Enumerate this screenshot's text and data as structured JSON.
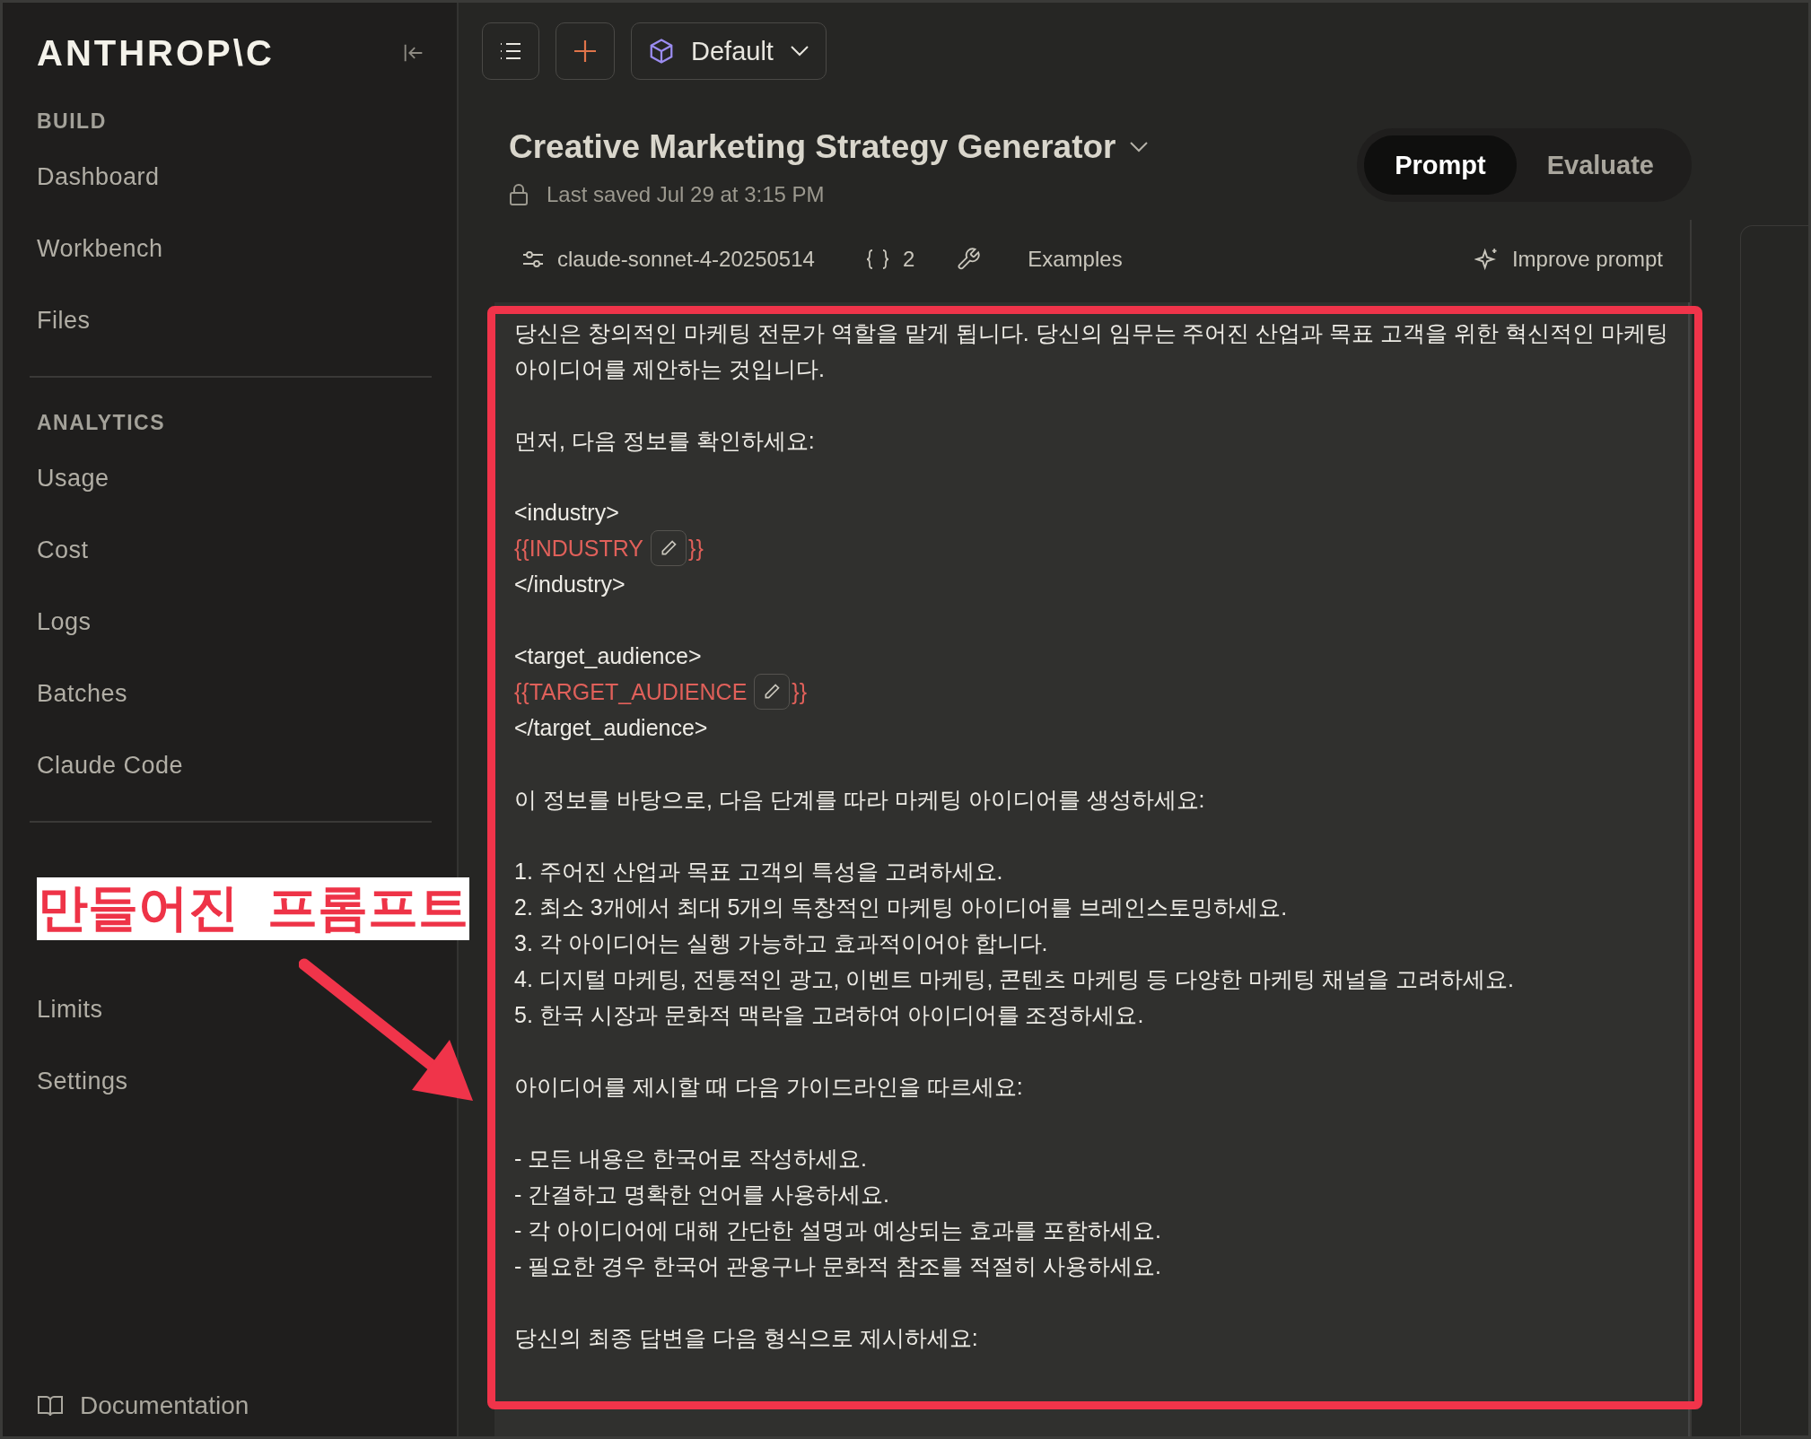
{
  "sidebar": {
    "logo": "ANTHROP\\C",
    "sections": [
      {
        "title": "BUILD",
        "items": [
          "Dashboard",
          "Workbench",
          "Files"
        ]
      },
      {
        "title": "ANALYTICS",
        "items": [
          "Usage",
          "Cost",
          "Logs",
          "Batches",
          "Claude Code"
        ]
      },
      {
        "items": [
          "Limits",
          "Settings"
        ]
      }
    ],
    "footer_link": "Documentation"
  },
  "toolbar": {
    "preset": "Default"
  },
  "prompt": {
    "title": "Creative Marketing Strategy Generator",
    "saved": "Last saved Jul 29 at 3:15 PM",
    "tabs": [
      {
        "label": "Prompt",
        "selected": true
      },
      {
        "label": "Evaluate",
        "selected": false
      }
    ],
    "model": "claude-sonnet-4-20250514",
    "variable_count": "2",
    "examples": "Examples",
    "improve": "Improve prompt",
    "lines": [
      {
        "kind": "text",
        "text": "당신은 창의적인 마케팅 전문가 역할을 맡게 됩니다. 당신의 임무는 주어진 산업과 목표 고객을 위한 혁신적인 마케팅"
      },
      {
        "kind": "text",
        "text": "아이디어를 제안하는 것입니다."
      },
      {
        "kind": "blank"
      },
      {
        "kind": "text",
        "text": "먼저, 다음 정보를 확인하세요:"
      },
      {
        "kind": "blank"
      },
      {
        "kind": "text",
        "text": "<industry>"
      },
      {
        "kind": "variable",
        "open": "{{INDUSTRY",
        "close": "}}"
      },
      {
        "kind": "text",
        "text": "</industry>"
      },
      {
        "kind": "blank"
      },
      {
        "kind": "text",
        "text": "<target_audience>"
      },
      {
        "kind": "variable",
        "open": "{{TARGET_AUDIENCE",
        "close": "}}"
      },
      {
        "kind": "text",
        "text": "</target_audience>"
      },
      {
        "kind": "blank"
      },
      {
        "kind": "text",
        "text": "이 정보를 바탕으로, 다음 단계를 따라 마케팅 아이디어를 생성하세요:"
      },
      {
        "kind": "blank"
      },
      {
        "kind": "text",
        "text": "1. 주어진 산업과 목표 고객의 특성을 고려하세요."
      },
      {
        "kind": "text",
        "text": "2. 최소 3개에서 최대 5개의 독창적인 마케팅 아이디어를 브레인스토밍하세요."
      },
      {
        "kind": "text",
        "text": "3. 각 아이디어는 실행 가능하고 효과적이어야 합니다."
      },
      {
        "kind": "text",
        "text": "4. 디지털 마케팅, 전통적인 광고, 이벤트 마케팅, 콘텐츠 마케팅 등 다양한 마케팅 채널을 고려하세요."
      },
      {
        "kind": "text",
        "text": "5. 한국 시장과 문화적 맥락을 고려하여 아이디어를 조정하세요."
      },
      {
        "kind": "blank"
      },
      {
        "kind": "text",
        "text": "아이디어를 제시할 때 다음 가이드라인을 따르세요:"
      },
      {
        "kind": "blank"
      },
      {
        "kind": "text",
        "text": "- 모든 내용은 한국어로 작성하세요."
      },
      {
        "kind": "text",
        "text": "- 간결하고 명확한 언어를 사용하세요."
      },
      {
        "kind": "text",
        "text": "- 각 아이디어에 대해 간단한 설명과 예상되는 효과를 포함하세요."
      },
      {
        "kind": "text",
        "text": "- 필요한 경우 한국어 관용구나 문화적 참조를 적절히 사용하세요."
      },
      {
        "kind": "blank"
      },
      {
        "kind": "text",
        "text": "당신의 최종 답변을 다음 형식으로 제시하세요:"
      }
    ]
  },
  "annotation": {
    "label": "만들어진  프롬프트"
  }
}
